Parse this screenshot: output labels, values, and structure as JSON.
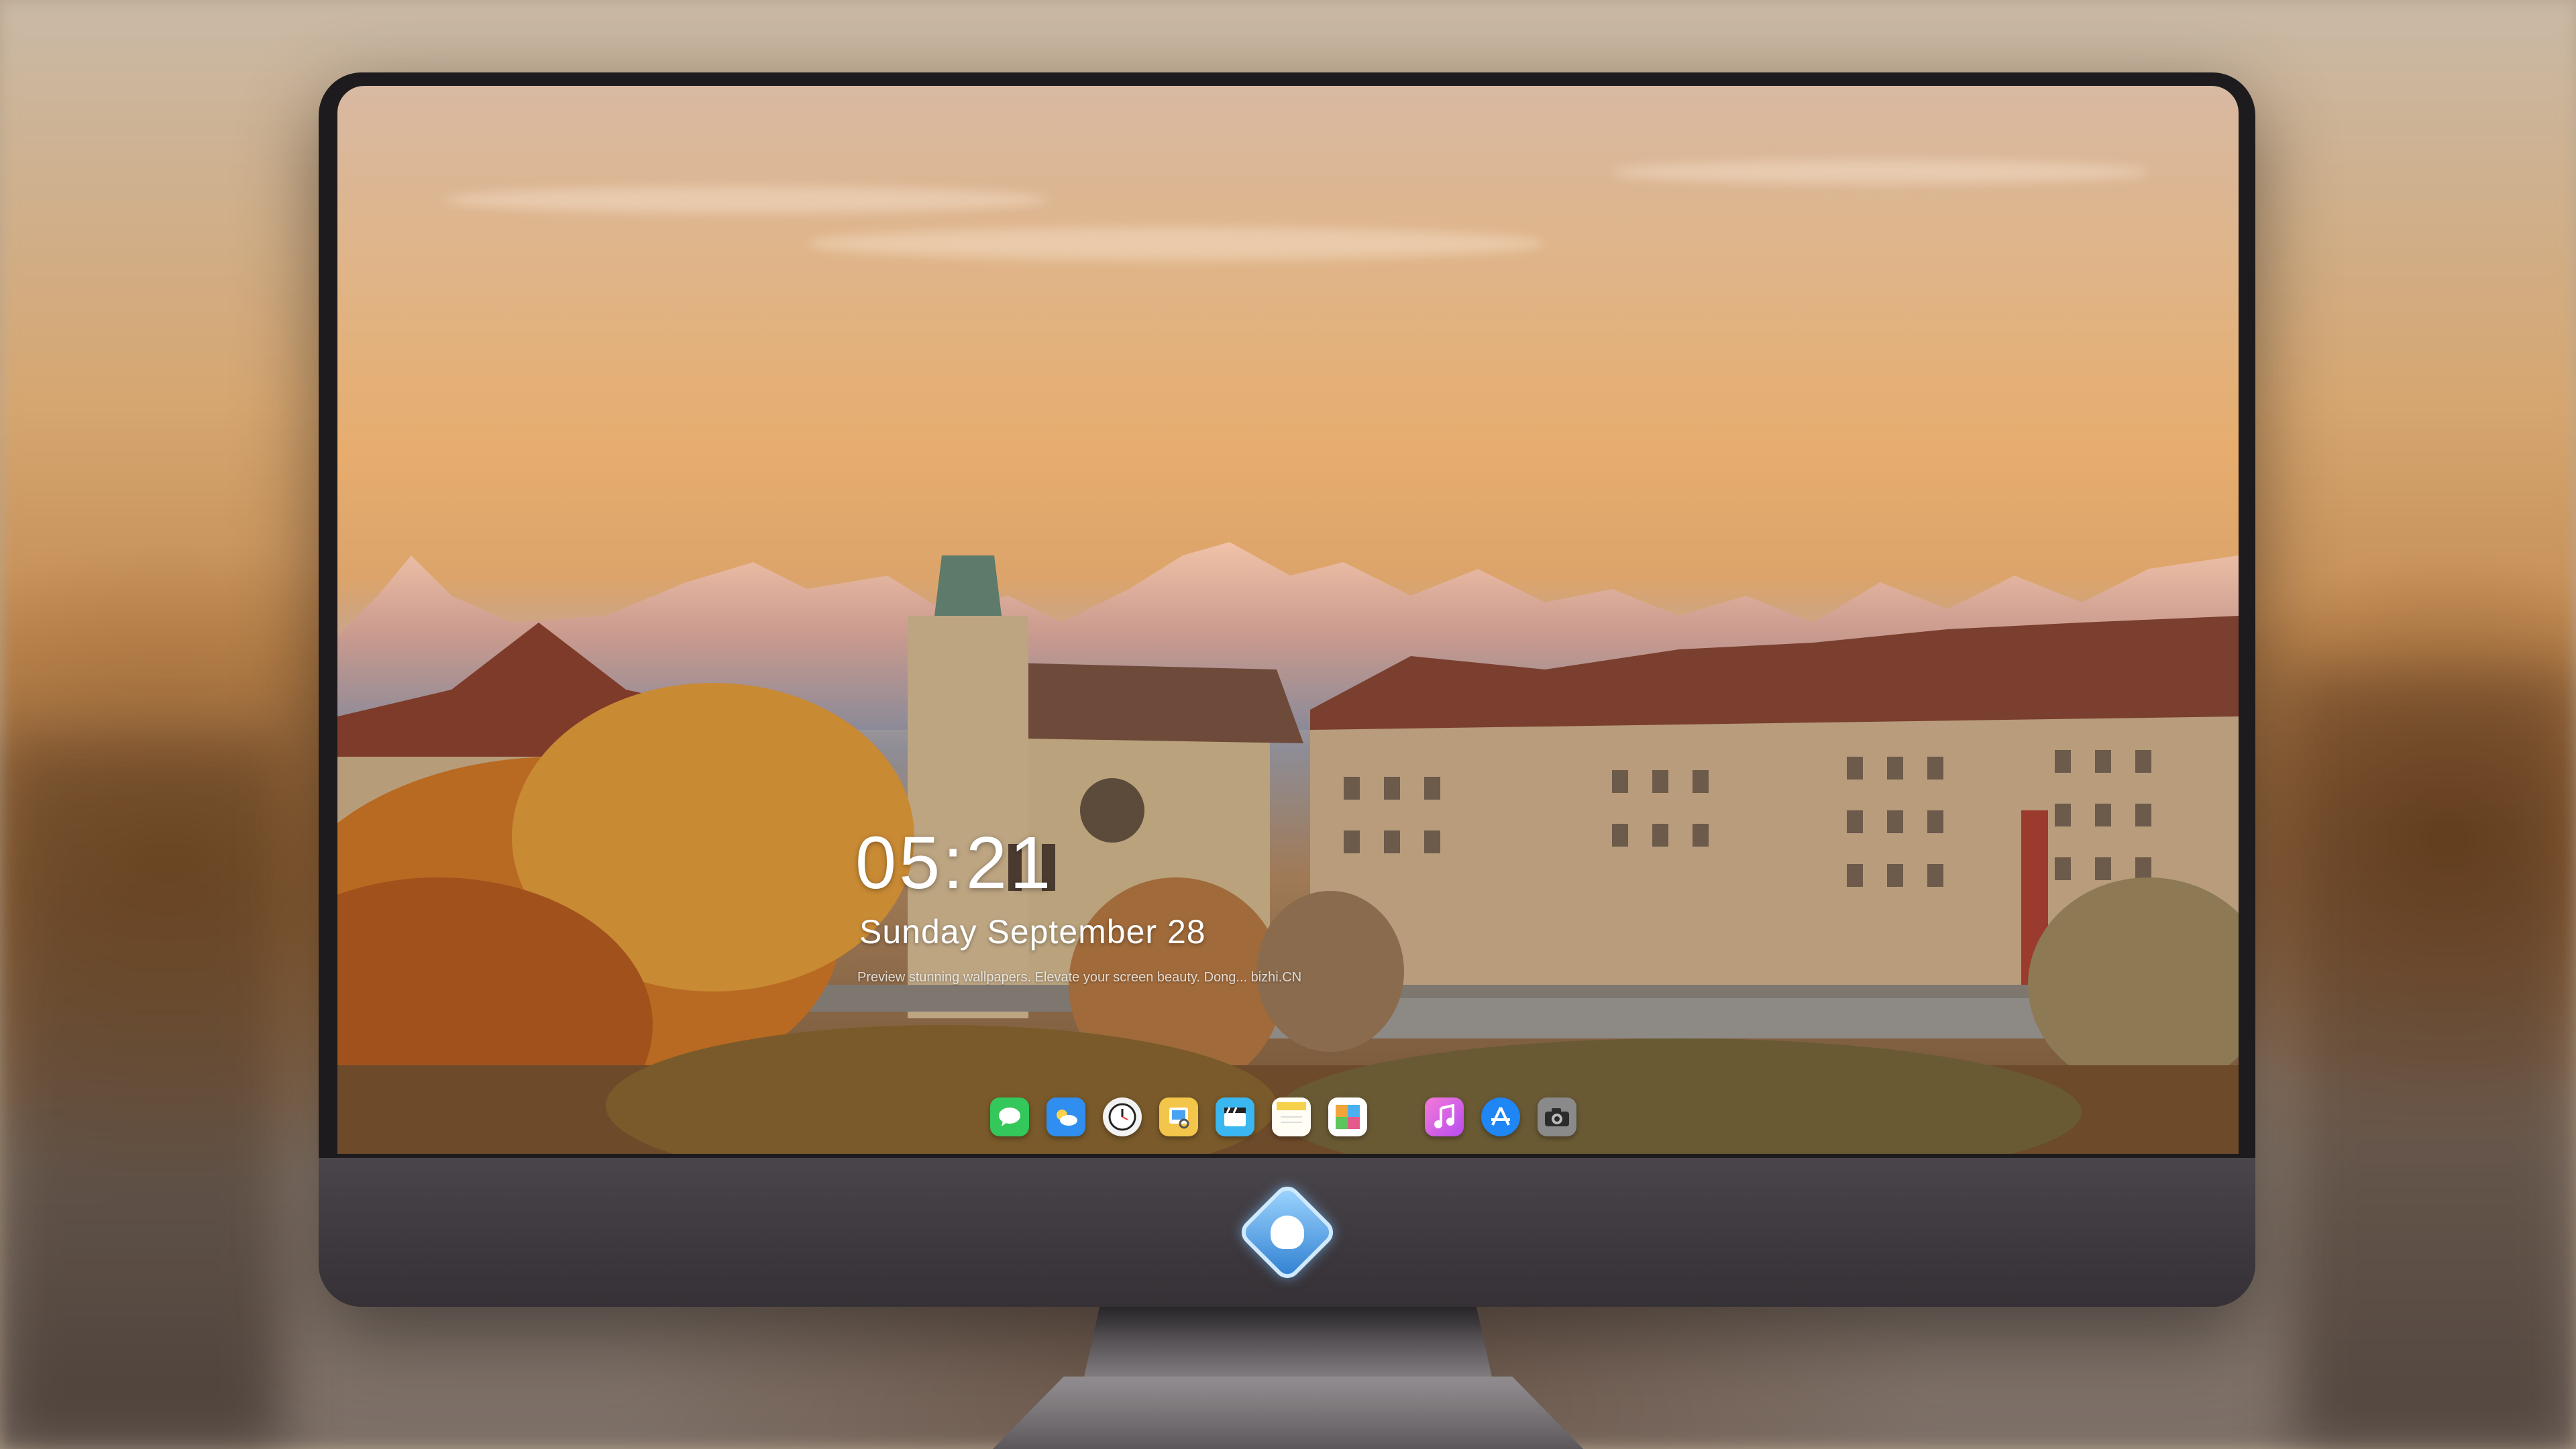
{
  "lockscreen": {
    "time": "05:21",
    "date": "Sunday September  28",
    "tagline": "Preview stunning wallpapers. Elevate your screen beauty. Dong... bizhi.CN"
  },
  "dock": {
    "apps": [
      {
        "name": "messages-icon",
        "color": "#34c759"
      },
      {
        "name": "weather-icon",
        "color": "#2f8ef0"
      },
      {
        "name": "clock-icon",
        "color": "#f2f2f2"
      },
      {
        "name": "preview-icon",
        "color": "#f3c54a"
      },
      {
        "name": "clips-icon",
        "color": "#3ab7f0"
      },
      {
        "name": "notes-icon",
        "color": "#f6d24c"
      },
      {
        "name": "photos-icon",
        "color": "#f0a43a"
      },
      {
        "name": "music-icon",
        "color": "#e44bd6"
      },
      {
        "name": "app-store-icon",
        "color": "#1e86f5"
      },
      {
        "name": "camera-icon",
        "color": "#6b6b6b"
      }
    ]
  }
}
